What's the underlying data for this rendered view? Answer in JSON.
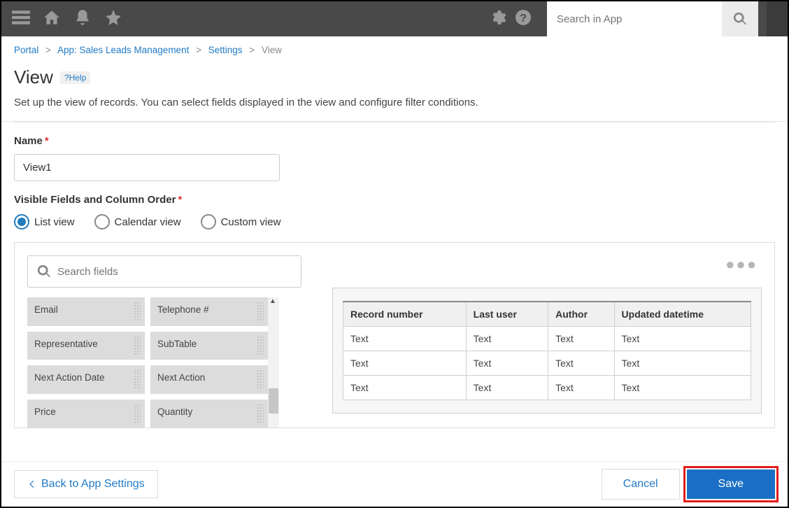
{
  "topbar": {
    "search_placeholder": "Search in App"
  },
  "breadcrumb": {
    "portal": "Portal",
    "app": "App: Sales Leads Management",
    "settings": "Settings",
    "current": "View"
  },
  "title": "View",
  "help_label": "?Help",
  "description": "Set up the view of records. You can select fields displayed in the view and configure filter conditions.",
  "name_label": "Name",
  "name_value": "View1",
  "visible_label": "Visible Fields and Column Order",
  "view_types": {
    "list": "List view",
    "calendar": "Calendar view",
    "custom": "Custom view"
  },
  "field_search_placeholder": "Search fields",
  "fields": [
    "Email",
    "Telephone #",
    "Representative",
    "SubTable",
    "Next Action Date",
    "Next Action",
    "Price",
    "Quantity"
  ],
  "table": {
    "headers": [
      "Record number",
      "Last user",
      "Author",
      "Updated datetime"
    ],
    "rows": [
      [
        "Text",
        "Text",
        "Text",
        "Text"
      ],
      [
        "Text",
        "Text",
        "Text",
        "Text"
      ],
      [
        "Text",
        "Text",
        "Text",
        "Text"
      ]
    ]
  },
  "footer": {
    "back": "Back to App Settings",
    "cancel": "Cancel",
    "save": "Save"
  }
}
